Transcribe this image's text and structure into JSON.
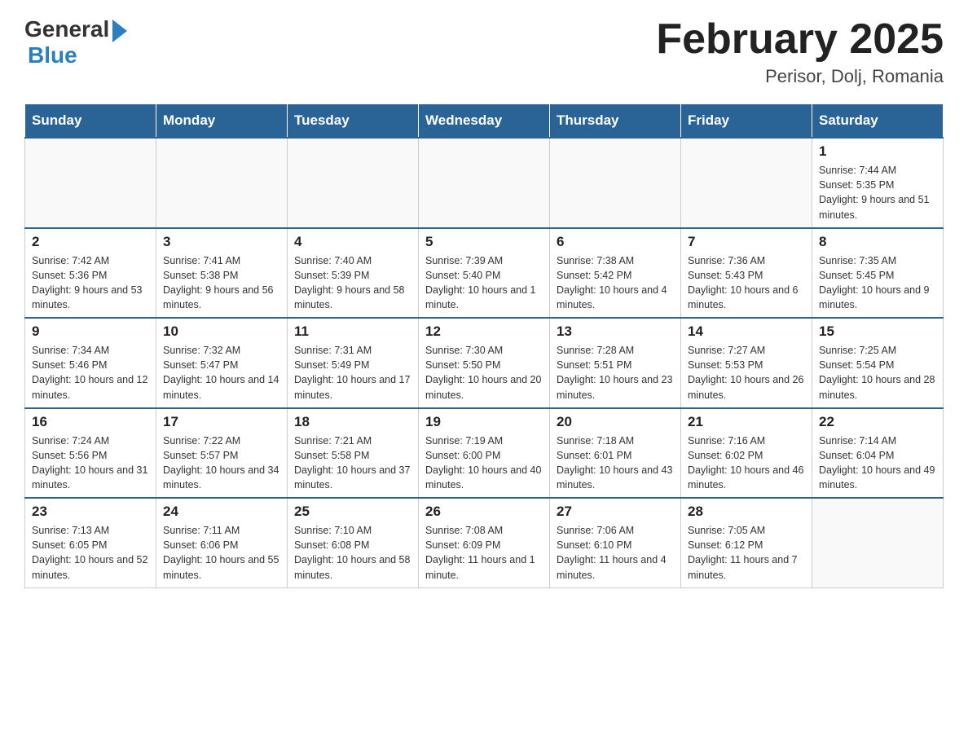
{
  "header": {
    "logo_general": "General",
    "logo_blue": "Blue",
    "month_title": "February 2025",
    "location": "Perisor, Dolj, Romania"
  },
  "days_of_week": [
    "Sunday",
    "Monday",
    "Tuesday",
    "Wednesday",
    "Thursday",
    "Friday",
    "Saturday"
  ],
  "weeks": [
    [
      {
        "day": "",
        "info": ""
      },
      {
        "day": "",
        "info": ""
      },
      {
        "day": "",
        "info": ""
      },
      {
        "day": "",
        "info": ""
      },
      {
        "day": "",
        "info": ""
      },
      {
        "day": "",
        "info": ""
      },
      {
        "day": "1",
        "info": "Sunrise: 7:44 AM\nSunset: 5:35 PM\nDaylight: 9 hours and 51 minutes."
      }
    ],
    [
      {
        "day": "2",
        "info": "Sunrise: 7:42 AM\nSunset: 5:36 PM\nDaylight: 9 hours and 53 minutes."
      },
      {
        "day": "3",
        "info": "Sunrise: 7:41 AM\nSunset: 5:38 PM\nDaylight: 9 hours and 56 minutes."
      },
      {
        "day": "4",
        "info": "Sunrise: 7:40 AM\nSunset: 5:39 PM\nDaylight: 9 hours and 58 minutes."
      },
      {
        "day": "5",
        "info": "Sunrise: 7:39 AM\nSunset: 5:40 PM\nDaylight: 10 hours and 1 minute."
      },
      {
        "day": "6",
        "info": "Sunrise: 7:38 AM\nSunset: 5:42 PM\nDaylight: 10 hours and 4 minutes."
      },
      {
        "day": "7",
        "info": "Sunrise: 7:36 AM\nSunset: 5:43 PM\nDaylight: 10 hours and 6 minutes."
      },
      {
        "day": "8",
        "info": "Sunrise: 7:35 AM\nSunset: 5:45 PM\nDaylight: 10 hours and 9 minutes."
      }
    ],
    [
      {
        "day": "9",
        "info": "Sunrise: 7:34 AM\nSunset: 5:46 PM\nDaylight: 10 hours and 12 minutes."
      },
      {
        "day": "10",
        "info": "Sunrise: 7:32 AM\nSunset: 5:47 PM\nDaylight: 10 hours and 14 minutes."
      },
      {
        "day": "11",
        "info": "Sunrise: 7:31 AM\nSunset: 5:49 PM\nDaylight: 10 hours and 17 minutes."
      },
      {
        "day": "12",
        "info": "Sunrise: 7:30 AM\nSunset: 5:50 PM\nDaylight: 10 hours and 20 minutes."
      },
      {
        "day": "13",
        "info": "Sunrise: 7:28 AM\nSunset: 5:51 PM\nDaylight: 10 hours and 23 minutes."
      },
      {
        "day": "14",
        "info": "Sunrise: 7:27 AM\nSunset: 5:53 PM\nDaylight: 10 hours and 26 minutes."
      },
      {
        "day": "15",
        "info": "Sunrise: 7:25 AM\nSunset: 5:54 PM\nDaylight: 10 hours and 28 minutes."
      }
    ],
    [
      {
        "day": "16",
        "info": "Sunrise: 7:24 AM\nSunset: 5:56 PM\nDaylight: 10 hours and 31 minutes."
      },
      {
        "day": "17",
        "info": "Sunrise: 7:22 AM\nSunset: 5:57 PM\nDaylight: 10 hours and 34 minutes."
      },
      {
        "day": "18",
        "info": "Sunrise: 7:21 AM\nSunset: 5:58 PM\nDaylight: 10 hours and 37 minutes."
      },
      {
        "day": "19",
        "info": "Sunrise: 7:19 AM\nSunset: 6:00 PM\nDaylight: 10 hours and 40 minutes."
      },
      {
        "day": "20",
        "info": "Sunrise: 7:18 AM\nSunset: 6:01 PM\nDaylight: 10 hours and 43 minutes."
      },
      {
        "day": "21",
        "info": "Sunrise: 7:16 AM\nSunset: 6:02 PM\nDaylight: 10 hours and 46 minutes."
      },
      {
        "day": "22",
        "info": "Sunrise: 7:14 AM\nSunset: 6:04 PM\nDaylight: 10 hours and 49 minutes."
      }
    ],
    [
      {
        "day": "23",
        "info": "Sunrise: 7:13 AM\nSunset: 6:05 PM\nDaylight: 10 hours and 52 minutes."
      },
      {
        "day": "24",
        "info": "Sunrise: 7:11 AM\nSunset: 6:06 PM\nDaylight: 10 hours and 55 minutes."
      },
      {
        "day": "25",
        "info": "Sunrise: 7:10 AM\nSunset: 6:08 PM\nDaylight: 10 hours and 58 minutes."
      },
      {
        "day": "26",
        "info": "Sunrise: 7:08 AM\nSunset: 6:09 PM\nDaylight: 11 hours and 1 minute."
      },
      {
        "day": "27",
        "info": "Sunrise: 7:06 AM\nSunset: 6:10 PM\nDaylight: 11 hours and 4 minutes."
      },
      {
        "day": "28",
        "info": "Sunrise: 7:05 AM\nSunset: 6:12 PM\nDaylight: 11 hours and 7 minutes."
      },
      {
        "day": "",
        "info": ""
      }
    ]
  ]
}
